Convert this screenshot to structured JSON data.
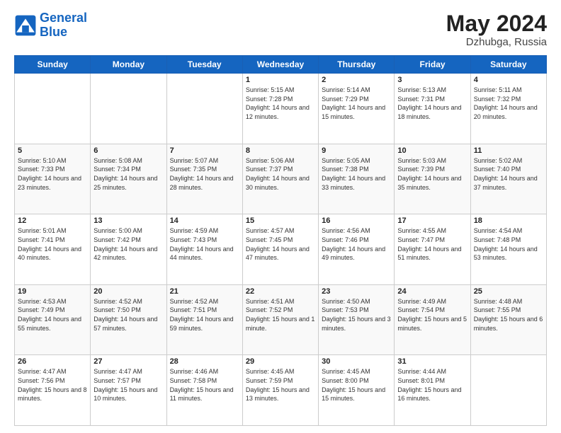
{
  "header": {
    "logo_line1": "General",
    "logo_line2": "Blue",
    "month_year": "May 2024",
    "location": "Dzhubga, Russia"
  },
  "weekdays": [
    "Sunday",
    "Monday",
    "Tuesday",
    "Wednesday",
    "Thursday",
    "Friday",
    "Saturday"
  ],
  "weeks": [
    [
      {
        "day": "",
        "sunrise": "",
        "sunset": "",
        "daylight": ""
      },
      {
        "day": "",
        "sunrise": "",
        "sunset": "",
        "daylight": ""
      },
      {
        "day": "",
        "sunrise": "",
        "sunset": "",
        "daylight": ""
      },
      {
        "day": "1",
        "sunrise": "Sunrise: 5:15 AM",
        "sunset": "Sunset: 7:28 PM",
        "daylight": "Daylight: 14 hours and 12 minutes."
      },
      {
        "day": "2",
        "sunrise": "Sunrise: 5:14 AM",
        "sunset": "Sunset: 7:29 PM",
        "daylight": "Daylight: 14 hours and 15 minutes."
      },
      {
        "day": "3",
        "sunrise": "Sunrise: 5:13 AM",
        "sunset": "Sunset: 7:31 PM",
        "daylight": "Daylight: 14 hours and 18 minutes."
      },
      {
        "day": "4",
        "sunrise": "Sunrise: 5:11 AM",
        "sunset": "Sunset: 7:32 PM",
        "daylight": "Daylight: 14 hours and 20 minutes."
      }
    ],
    [
      {
        "day": "5",
        "sunrise": "Sunrise: 5:10 AM",
        "sunset": "Sunset: 7:33 PM",
        "daylight": "Daylight: 14 hours and 23 minutes."
      },
      {
        "day": "6",
        "sunrise": "Sunrise: 5:08 AM",
        "sunset": "Sunset: 7:34 PM",
        "daylight": "Daylight: 14 hours and 25 minutes."
      },
      {
        "day": "7",
        "sunrise": "Sunrise: 5:07 AM",
        "sunset": "Sunset: 7:35 PM",
        "daylight": "Daylight: 14 hours and 28 minutes."
      },
      {
        "day": "8",
        "sunrise": "Sunrise: 5:06 AM",
        "sunset": "Sunset: 7:37 PM",
        "daylight": "Daylight: 14 hours and 30 minutes."
      },
      {
        "day": "9",
        "sunrise": "Sunrise: 5:05 AM",
        "sunset": "Sunset: 7:38 PM",
        "daylight": "Daylight: 14 hours and 33 minutes."
      },
      {
        "day": "10",
        "sunrise": "Sunrise: 5:03 AM",
        "sunset": "Sunset: 7:39 PM",
        "daylight": "Daylight: 14 hours and 35 minutes."
      },
      {
        "day": "11",
        "sunrise": "Sunrise: 5:02 AM",
        "sunset": "Sunset: 7:40 PM",
        "daylight": "Daylight: 14 hours and 37 minutes."
      }
    ],
    [
      {
        "day": "12",
        "sunrise": "Sunrise: 5:01 AM",
        "sunset": "Sunset: 7:41 PM",
        "daylight": "Daylight: 14 hours and 40 minutes."
      },
      {
        "day": "13",
        "sunrise": "Sunrise: 5:00 AM",
        "sunset": "Sunset: 7:42 PM",
        "daylight": "Daylight: 14 hours and 42 minutes."
      },
      {
        "day": "14",
        "sunrise": "Sunrise: 4:59 AM",
        "sunset": "Sunset: 7:43 PM",
        "daylight": "Daylight: 14 hours and 44 minutes."
      },
      {
        "day": "15",
        "sunrise": "Sunrise: 4:57 AM",
        "sunset": "Sunset: 7:45 PM",
        "daylight": "Daylight: 14 hours and 47 minutes."
      },
      {
        "day": "16",
        "sunrise": "Sunrise: 4:56 AM",
        "sunset": "Sunset: 7:46 PM",
        "daylight": "Daylight: 14 hours and 49 minutes."
      },
      {
        "day": "17",
        "sunrise": "Sunrise: 4:55 AM",
        "sunset": "Sunset: 7:47 PM",
        "daylight": "Daylight: 14 hours and 51 minutes."
      },
      {
        "day": "18",
        "sunrise": "Sunrise: 4:54 AM",
        "sunset": "Sunset: 7:48 PM",
        "daylight": "Daylight: 14 hours and 53 minutes."
      }
    ],
    [
      {
        "day": "19",
        "sunrise": "Sunrise: 4:53 AM",
        "sunset": "Sunset: 7:49 PM",
        "daylight": "Daylight: 14 hours and 55 minutes."
      },
      {
        "day": "20",
        "sunrise": "Sunrise: 4:52 AM",
        "sunset": "Sunset: 7:50 PM",
        "daylight": "Daylight: 14 hours and 57 minutes."
      },
      {
        "day": "21",
        "sunrise": "Sunrise: 4:52 AM",
        "sunset": "Sunset: 7:51 PM",
        "daylight": "Daylight: 14 hours and 59 minutes."
      },
      {
        "day": "22",
        "sunrise": "Sunrise: 4:51 AM",
        "sunset": "Sunset: 7:52 PM",
        "daylight": "Daylight: 15 hours and 1 minute."
      },
      {
        "day": "23",
        "sunrise": "Sunrise: 4:50 AM",
        "sunset": "Sunset: 7:53 PM",
        "daylight": "Daylight: 15 hours and 3 minutes."
      },
      {
        "day": "24",
        "sunrise": "Sunrise: 4:49 AM",
        "sunset": "Sunset: 7:54 PM",
        "daylight": "Daylight: 15 hours and 5 minutes."
      },
      {
        "day": "25",
        "sunrise": "Sunrise: 4:48 AM",
        "sunset": "Sunset: 7:55 PM",
        "daylight": "Daylight: 15 hours and 6 minutes."
      }
    ],
    [
      {
        "day": "26",
        "sunrise": "Sunrise: 4:47 AM",
        "sunset": "Sunset: 7:56 PM",
        "daylight": "Daylight: 15 hours and 8 minutes."
      },
      {
        "day": "27",
        "sunrise": "Sunrise: 4:47 AM",
        "sunset": "Sunset: 7:57 PM",
        "daylight": "Daylight: 15 hours and 10 minutes."
      },
      {
        "day": "28",
        "sunrise": "Sunrise: 4:46 AM",
        "sunset": "Sunset: 7:58 PM",
        "daylight": "Daylight: 15 hours and 11 minutes."
      },
      {
        "day": "29",
        "sunrise": "Sunrise: 4:45 AM",
        "sunset": "Sunset: 7:59 PM",
        "daylight": "Daylight: 15 hours and 13 minutes."
      },
      {
        "day": "30",
        "sunrise": "Sunrise: 4:45 AM",
        "sunset": "Sunset: 8:00 PM",
        "daylight": "Daylight: 15 hours and 15 minutes."
      },
      {
        "day": "31",
        "sunrise": "Sunrise: 4:44 AM",
        "sunset": "Sunset: 8:01 PM",
        "daylight": "Daylight: 15 hours and 16 minutes."
      },
      {
        "day": "",
        "sunrise": "",
        "sunset": "",
        "daylight": ""
      }
    ]
  ]
}
